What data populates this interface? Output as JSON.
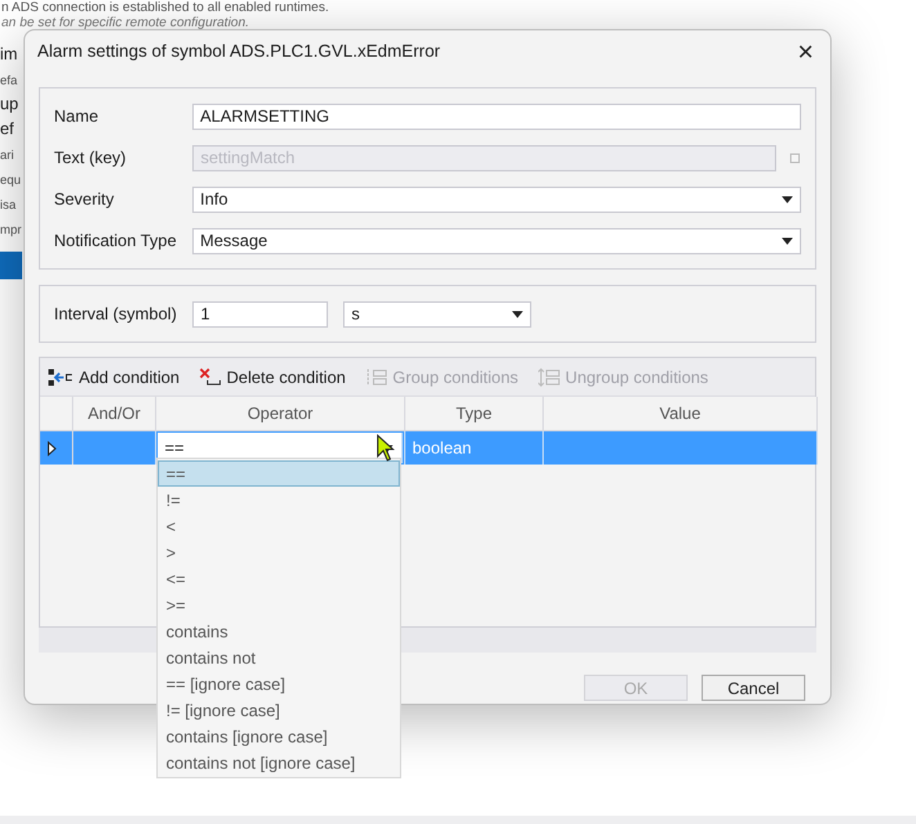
{
  "background_page": {
    "lines": [
      {
        "text": "n ADS connection is established to all enabled runtimes.",
        "kind": "note"
      },
      {
        "text": "an be set for specific remote configuration.",
        "kind": "hint"
      }
    ],
    "fragments": [
      {
        "text": "im",
        "kind": "heading"
      },
      {
        "text": "efa",
        "kind": "small"
      },
      {
        "text": "up",
        "kind": "heading"
      },
      {
        "text": "ef",
        "kind": "heading"
      },
      {
        "text": "ari",
        "kind": "small"
      },
      {
        "text": "equ",
        "kind": "small"
      },
      {
        "text": "isa",
        "kind": "small"
      },
      {
        "text": "mpr",
        "kind": "small"
      }
    ]
  },
  "dialog": {
    "title": "Alarm settings of symbol ADS.PLC1.GVL.xEdmError",
    "close": "×",
    "fields": [
      {
        "label": "Name",
        "kind": "text",
        "value": "ALARMSETTING",
        "disabled": false
      },
      {
        "label": "Text (key)",
        "kind": "text",
        "value": "settingMatch",
        "disabled": true,
        "checkbox": {
          "checked": false
        }
      },
      {
        "label": "Severity",
        "kind": "select",
        "value": "Info",
        "disabled": false
      },
      {
        "label": "Notification Type",
        "kind": "select",
        "value": "Message",
        "disabled": false
      }
    ],
    "interval": {
      "label": "Interval (symbol)",
      "value": "1",
      "unit": "s"
    },
    "toolbar": [
      {
        "label": "Add condition",
        "kind": "add",
        "disabled": false
      },
      {
        "label": "Delete condition",
        "kind": "delete",
        "disabled": false
      },
      {
        "label": "Group conditions",
        "kind": "group",
        "disabled": true
      },
      {
        "label": "Ungroup conditions",
        "kind": "ungroup",
        "disabled": true
      }
    ],
    "table": {
      "columns": [
        "And/Or",
        "Operator",
        "Type",
        "Value"
      ],
      "rows": [
        {
          "selected": true,
          "operator": "==",
          "type": "boolean"
        }
      ]
    },
    "operator_dropdown": {
      "options": [
        {
          "label": "==",
          "selected": true
        },
        {
          "label": "!=",
          "selected": false
        },
        {
          "label": "<",
          "selected": false
        },
        {
          "label": ">",
          "selected": false
        },
        {
          "label": "<=",
          "selected": false
        },
        {
          "label": ">=",
          "selected": false
        },
        {
          "label": "contains",
          "selected": false
        },
        {
          "label": "contains not",
          "selected": false
        },
        {
          "label": "== [ignore case]",
          "selected": false
        },
        {
          "label": "!= [ignore case]",
          "selected": false
        },
        {
          "label": "contains [ignore case]",
          "selected": false
        },
        {
          "label": "contains not [ignore case]",
          "selected": false
        }
      ]
    },
    "buttons": [
      {
        "label": "OK",
        "disabled": true
      },
      {
        "label": "Cancel",
        "disabled": false
      }
    ]
  }
}
